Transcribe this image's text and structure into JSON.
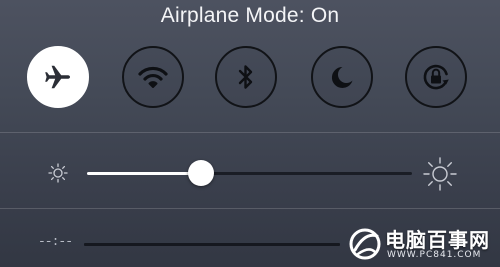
{
  "status": {
    "title": "Airplane Mode: On"
  },
  "toggles": [
    {
      "name": "airplane-mode",
      "icon": "airplane-icon",
      "active": true
    },
    {
      "name": "wifi",
      "icon": "wifi-icon",
      "active": false
    },
    {
      "name": "bluetooth",
      "icon": "bluetooth-icon",
      "active": false
    },
    {
      "name": "do-not-disturb",
      "icon": "moon-icon",
      "active": false
    },
    {
      "name": "rotation-lock",
      "icon": "rotation-lock-icon",
      "active": false
    }
  ],
  "brightness": {
    "level": 0.35,
    "low_icon": "sun-small-icon",
    "high_icon": "sun-large-icon"
  },
  "music": {
    "elapsed": "--:--"
  },
  "watermark": {
    "text": "电脑百事网",
    "url": "WWW.PC841.COM"
  },
  "colors": {
    "background": "#444a57",
    "active_toggle": "#ffffff",
    "toggle_border": "#111317",
    "slider_fill": "#ffffff",
    "slider_track": "#1a1d25"
  }
}
